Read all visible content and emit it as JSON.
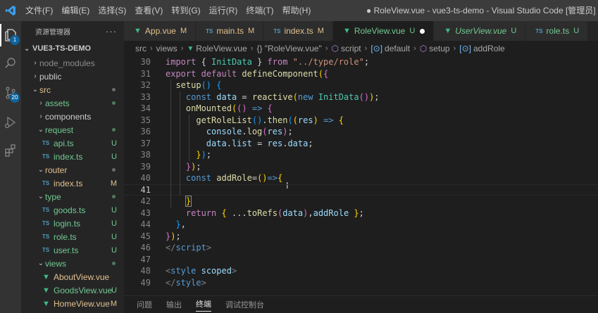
{
  "titlebar": {
    "menu": [
      "文件(F)",
      "编辑(E)",
      "选择(S)",
      "查看(V)",
      "转到(G)",
      "运行(R)",
      "终端(T)",
      "帮助(H)"
    ],
    "window_title": "● RoleView.vue - vue3-ts-demo - Visual Studio Code [管理员]"
  },
  "activitybar": {
    "source_control_badge": "20",
    "explorer_badge": "1"
  },
  "sidebar": {
    "header": "资源管理器",
    "more": "···",
    "project": "VUE3-TS-DEMO",
    "items": [
      {
        "label": "node_modules",
        "kind": "folder-collapsed",
        "depth": 1,
        "status": "",
        "cls": "c-ignored"
      },
      {
        "label": "public",
        "kind": "folder-collapsed",
        "depth": 1,
        "status": "",
        "cls": "c-dir"
      },
      {
        "label": "src",
        "kind": "folder-open",
        "depth": 1,
        "status": "dot",
        "cls": "c-m"
      },
      {
        "label": "assets",
        "kind": "folder-collapsed",
        "depth": 2,
        "status": "dot-green",
        "cls": "c-u"
      },
      {
        "label": "components",
        "kind": "folder-collapsed",
        "depth": 2,
        "status": "",
        "cls": "c-dir"
      },
      {
        "label": "request",
        "kind": "folder-open",
        "depth": 2,
        "status": "dot-green",
        "cls": "c-u"
      },
      {
        "label": "api.ts",
        "kind": "ts",
        "depth": 3,
        "status": "U",
        "cls": "c-u"
      },
      {
        "label": "index.ts",
        "kind": "ts",
        "depth": 3,
        "status": "U",
        "cls": "c-u"
      },
      {
        "label": "router",
        "kind": "folder-open",
        "depth": 2,
        "status": "dot",
        "cls": "c-m"
      },
      {
        "label": "index.ts",
        "kind": "ts",
        "depth": 3,
        "status": "M",
        "cls": "c-m"
      },
      {
        "label": "type",
        "kind": "folder-open",
        "depth": 2,
        "status": "dot-green",
        "cls": "c-u"
      },
      {
        "label": "goods.ts",
        "kind": "ts",
        "depth": 3,
        "status": "U",
        "cls": "c-u"
      },
      {
        "label": "login.ts",
        "kind": "ts",
        "depth": 3,
        "status": "U",
        "cls": "c-u"
      },
      {
        "label": "role.ts",
        "kind": "ts",
        "depth": 3,
        "status": "U",
        "cls": "c-u"
      },
      {
        "label": "user.ts",
        "kind": "ts",
        "depth": 3,
        "status": "U",
        "cls": "c-u"
      },
      {
        "label": "views",
        "kind": "folder-open",
        "depth": 2,
        "status": "dot-green",
        "cls": "c-u"
      },
      {
        "label": "AboutView.vue",
        "kind": "vue",
        "depth": 3,
        "status": "",
        "cls": "c-m"
      },
      {
        "label": "GoodsView.vue",
        "kind": "vue",
        "depth": 3,
        "status": "U",
        "cls": "c-u"
      },
      {
        "label": "HomeView.vue",
        "kind": "vue",
        "depth": 3,
        "status": "M",
        "cls": "c-m"
      }
    ]
  },
  "tabs": [
    {
      "label": "App.vue",
      "icon": "vue",
      "status": "M",
      "cls": "c-m",
      "active": false,
      "italic": false,
      "dirty": false
    },
    {
      "label": "main.ts",
      "icon": "ts",
      "status": "M",
      "cls": "c-m",
      "active": false,
      "italic": false,
      "dirty": false
    },
    {
      "label": "index.ts",
      "icon": "ts",
      "status": "M",
      "cls": "c-m",
      "active": false,
      "italic": false,
      "dirty": false
    },
    {
      "label": "RoleView.vue",
      "icon": "vue",
      "status": "U",
      "cls": "c-u",
      "active": true,
      "italic": false,
      "dirty": true
    },
    {
      "label": "UserView.vue",
      "icon": "vue",
      "status": "U",
      "cls": "c-u",
      "active": false,
      "italic": true,
      "dirty": false
    },
    {
      "label": "role.ts",
      "icon": "ts",
      "status": "U",
      "cls": "c-u",
      "active": false,
      "italic": false,
      "dirty": false
    }
  ],
  "breadcrumb": [
    "src",
    "views",
    "RoleView.vue",
    "{} \"RoleView.vue\"",
    "script",
    "default",
    "setup",
    "addRole"
  ],
  "editor": {
    "current_line": "41",
    "lines": [
      {
        "n": "30",
        "tokens": [
          [
            "kw",
            "import"
          ],
          [
            "pun",
            " { "
          ],
          [
            "type",
            "InitData"
          ],
          [
            "pun",
            " } "
          ],
          [
            "kw",
            "from"
          ],
          [
            "pun",
            " "
          ],
          [
            "str",
            "\"../type/role\""
          ],
          [
            "pun",
            ";"
          ]
        ]
      },
      {
        "n": "31",
        "tokens": [
          [
            "kw",
            "export"
          ],
          [
            "pun",
            " "
          ],
          [
            "kw",
            "default"
          ],
          [
            "pun",
            " "
          ],
          [
            "fn",
            "defineComponent"
          ],
          [
            "br1",
            "("
          ],
          [
            "br2",
            "{"
          ]
        ]
      },
      {
        "n": "32",
        "tokens": [
          [
            "pun",
            "  "
          ],
          [
            "fn",
            "setup"
          ],
          [
            "br3",
            "()"
          ],
          [
            "pun",
            " "
          ],
          [
            "br3",
            "{"
          ]
        ]
      },
      {
        "n": "33",
        "tokens": [
          [
            "pun",
            "    "
          ],
          [
            "kw2",
            "const"
          ],
          [
            "pun",
            " "
          ],
          [
            "var",
            "data"
          ],
          [
            "pun",
            " = "
          ],
          [
            "fn",
            "reactive"
          ],
          [
            "br1",
            "("
          ],
          [
            "kw2",
            "new"
          ],
          [
            "pun",
            " "
          ],
          [
            "type",
            "InitData"
          ],
          [
            "br2",
            "()"
          ],
          [
            "br1",
            ")"
          ],
          [
            "pun",
            ";"
          ]
        ]
      },
      {
        "n": "34",
        "tokens": [
          [
            "pun",
            "    "
          ],
          [
            "fn",
            "onMounted"
          ],
          [
            "br1",
            "("
          ],
          [
            "br2",
            "()"
          ],
          [
            "pun",
            " "
          ],
          [
            "kw2",
            "=>"
          ],
          [
            "pun",
            " "
          ],
          [
            "br2",
            "{"
          ]
        ]
      },
      {
        "n": "35",
        "tokens": [
          [
            "pun",
            "      "
          ],
          [
            "fn",
            "getRoleList"
          ],
          [
            "br3",
            "()"
          ],
          [
            "pun",
            "."
          ],
          [
            "fn",
            "then"
          ],
          [
            "br3",
            "("
          ],
          [
            "br1",
            "("
          ],
          [
            "var",
            "res"
          ],
          [
            "br1",
            ")"
          ],
          [
            "pun",
            " "
          ],
          [
            "kw2",
            "=>"
          ],
          [
            "pun",
            " "
          ],
          [
            "br1",
            "{"
          ]
        ]
      },
      {
        "n": "36",
        "tokens": [
          [
            "pun",
            "        "
          ],
          [
            "var",
            "console"
          ],
          [
            "pun",
            "."
          ],
          [
            "fn",
            "log"
          ],
          [
            "br2",
            "("
          ],
          [
            "var",
            "res"
          ],
          [
            "br2",
            ")"
          ],
          [
            "pun",
            ";"
          ]
        ]
      },
      {
        "n": "37",
        "tokens": [
          [
            "pun",
            "        "
          ],
          [
            "var",
            "data"
          ],
          [
            "pun",
            "."
          ],
          [
            "var",
            "list"
          ],
          [
            "pun",
            " = "
          ],
          [
            "var",
            "res"
          ],
          [
            "pun",
            "."
          ],
          [
            "var",
            "data"
          ],
          [
            "pun",
            ";"
          ]
        ]
      },
      {
        "n": "38",
        "tokens": [
          [
            "pun",
            "      "
          ],
          [
            "br1",
            "}"
          ],
          [
            "br3",
            ")"
          ],
          [
            "pun",
            ";"
          ]
        ]
      },
      {
        "n": "39",
        "tokens": [
          [
            "pun",
            "    "
          ],
          [
            "br2",
            "}"
          ],
          [
            "br1",
            ")"
          ],
          [
            "pun",
            ";"
          ]
        ]
      },
      {
        "n": "40",
        "tokens": [
          [
            "pun",
            "    "
          ],
          [
            "kw2",
            "const"
          ],
          [
            "pun",
            " "
          ],
          [
            "fn",
            "addRole"
          ],
          [
            "pun",
            "="
          ],
          [
            "br1",
            "()"
          ],
          [
            "kw2",
            "=>"
          ],
          [
            "br1",
            "{"
          ]
        ]
      },
      {
        "n": "41",
        "tokens": []
      },
      {
        "n": "42",
        "tokens": [
          [
            "pun",
            "    "
          ],
          [
            "br1",
            "}"
          ]
        ]
      },
      {
        "n": "43",
        "tokens": [
          [
            "pun",
            "    "
          ],
          [
            "kw",
            "return"
          ],
          [
            "pun",
            " "
          ],
          [
            "br1",
            "{"
          ],
          [
            "pun",
            " ..."
          ],
          [
            "fn",
            "toRefs"
          ],
          [
            "br2",
            "("
          ],
          [
            "var",
            "data"
          ],
          [
            "br2",
            ")"
          ],
          [
            "pun",
            ","
          ],
          [
            "var",
            "addRole"
          ],
          [
            "pun",
            " "
          ],
          [
            "br1",
            "}"
          ],
          [
            "pun",
            ";"
          ]
        ]
      },
      {
        "n": "44",
        "tokens": [
          [
            "pun",
            "  "
          ],
          [
            "br3",
            "}"
          ],
          [
            "pun",
            ","
          ]
        ]
      },
      {
        "n": "45",
        "tokens": [
          [
            "br2",
            "}"
          ],
          [
            "br1",
            ")"
          ],
          [
            "pun",
            ";"
          ]
        ]
      },
      {
        "n": "46",
        "tokens": [
          [
            "tag",
            "</"
          ],
          [
            "tagn",
            "script"
          ],
          [
            "tag",
            ">"
          ]
        ]
      },
      {
        "n": "47",
        "tokens": []
      },
      {
        "n": "48",
        "tokens": [
          [
            "tag",
            "<"
          ],
          [
            "tagn",
            "style"
          ],
          [
            "pun",
            " "
          ],
          [
            "attr",
            "scoped"
          ],
          [
            "tag",
            ">"
          ]
        ]
      },
      {
        "n": "49",
        "tokens": [
          [
            "tag",
            "</"
          ],
          [
            "tagn",
            "style"
          ],
          [
            "tag",
            ">"
          ]
        ]
      }
    ]
  },
  "panel_tabs": [
    "问题",
    "输出",
    "终端",
    "调试控制台"
  ],
  "panel_active": "终端"
}
